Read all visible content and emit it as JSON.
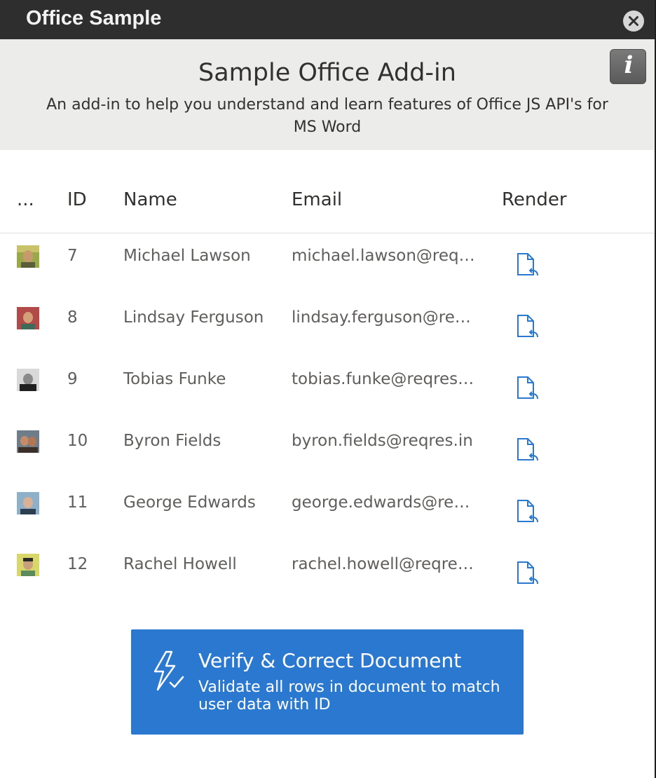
{
  "window": {
    "title": "Office Sample"
  },
  "header": {
    "title": "Sample Office Add-in",
    "subtitle": "An add-in to help you understand and learn features of Office JS API's for MS Word"
  },
  "table": {
    "columns": [
      "...",
      "ID",
      "Name",
      "Email",
      "Render"
    ],
    "rows": [
      {
        "id": "7",
        "name": "Michael Lawson",
        "email": "michael.lawson@reqres.in"
      },
      {
        "id": "8",
        "name": "Lindsay Ferguson",
        "email": "lindsay.ferguson@reqres.in"
      },
      {
        "id": "9",
        "name": "Tobias Funke",
        "email": "tobias.funke@reqres.in"
      },
      {
        "id": "10",
        "name": "Byron Fields",
        "email": "byron.fields@reqres.in"
      },
      {
        "id": "11",
        "name": "George Edwards",
        "email": "george.edwards@reqres.in"
      },
      {
        "id": "12",
        "name": "Rachel Howell",
        "email": "rachel.howell@reqres.in"
      }
    ]
  },
  "action": {
    "title": "Verify & Correct Document",
    "description": "Validate all rows in document to match user data with ID"
  },
  "icons": {
    "close": "close-icon",
    "info": "info-icon",
    "render": "document-render-icon",
    "verify": "lightning-check-icon"
  },
  "colors": {
    "titlebar": "#2e2e2e",
    "header_band": "#ececea",
    "accent": "#2b78d0"
  }
}
